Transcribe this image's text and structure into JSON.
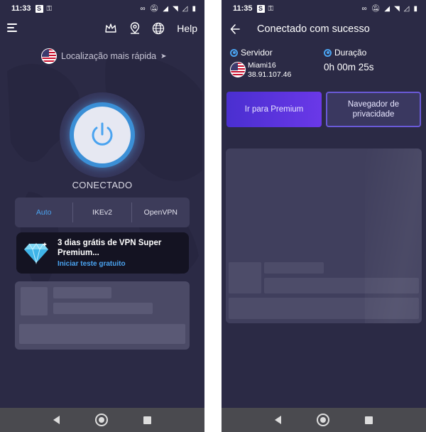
{
  "status_bar": {
    "left_time": "11:33",
    "right_time": "11:35",
    "notification_letter": "S"
  },
  "left": {
    "help_label": "Help",
    "location_label": "Localização mais rápida",
    "location_arrow": "➤",
    "status": "CONECTADO",
    "protocols": [
      {
        "label": "Auto",
        "active": true
      },
      {
        "label": "IKEv2",
        "active": false
      },
      {
        "label": "OpenVPN",
        "active": false
      }
    ],
    "promo": {
      "title": "3 dias grátis de VPN Super Premium...",
      "link": "Iniciar teste gratuito"
    },
    "icons": [
      "menu-icon",
      "crown-icon",
      "location-pin-icon",
      "globe-icon",
      "power-icon",
      "diamond-icon",
      "us-flag-icon"
    ]
  },
  "right": {
    "title": "Conectado com sucesso",
    "server_label": "Servidor",
    "server_name": "Miami16",
    "server_ip": "38.91.107.46",
    "duration_label": "Duração",
    "duration_value": "0h 00m 25s",
    "premium_button": "Ir para Premium",
    "privacy_button": "Navegador de privacidade",
    "icons": [
      "back-arrow-icon",
      "radio-icon",
      "us-flag-icon"
    ]
  },
  "colors": {
    "background": "#2b2a45",
    "accent_blue": "#4aa3f0",
    "premium_purple": "#5a34e0",
    "nav_bar": "#4a4a4f"
  }
}
